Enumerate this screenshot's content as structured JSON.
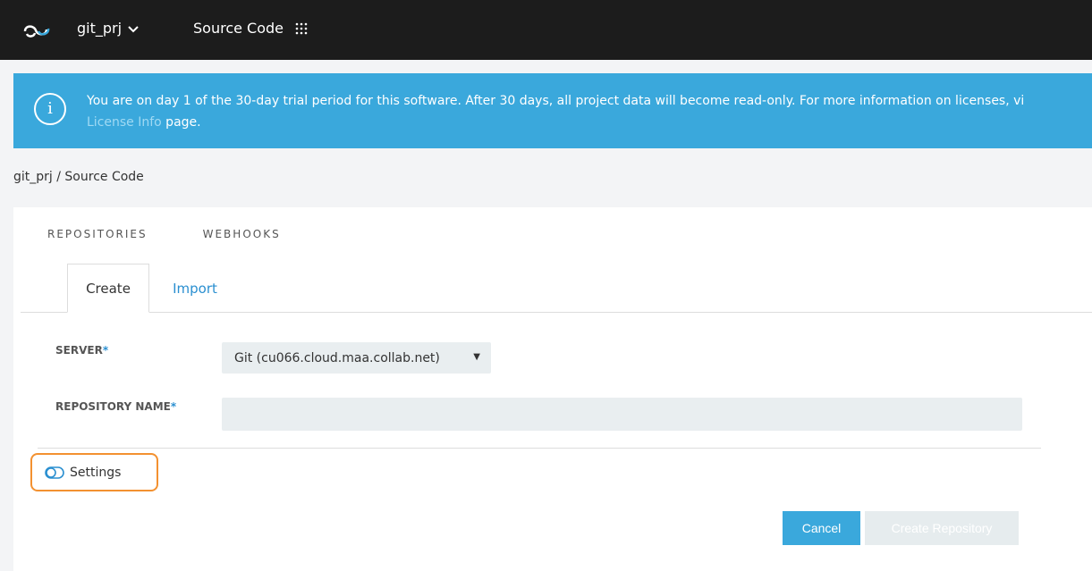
{
  "header": {
    "project": "git_prj",
    "app_title": "Source Code"
  },
  "banner": {
    "icon": "i",
    "message_line1": "You are on day 1 of the 30-day trial period for this software. After 30 days, all project data will become read-only. For more information on licenses, vi",
    "link_text": "License Info",
    "message_line2_suffix": " page."
  },
  "breadcrumb": "git_prj / Source Code",
  "tabs": {
    "main": [
      "REPOSITORIES",
      "WEBHOOKS"
    ],
    "sub_active": "Create",
    "sub_other": "Import"
  },
  "form": {
    "server_label": "SERVER",
    "required_mark": "*",
    "server_value": "Git (cu066.cloud.maa.collab.net)",
    "repo_name_label": "REPOSITORY NAME",
    "repo_name_value": ""
  },
  "settings_label": "Settings",
  "buttons": {
    "cancel": "Cancel",
    "create": "Create Repository"
  },
  "colors": {
    "accent": "#3aa8dc",
    "highlight": "#f39130",
    "topbar": "#1c1c1c"
  }
}
